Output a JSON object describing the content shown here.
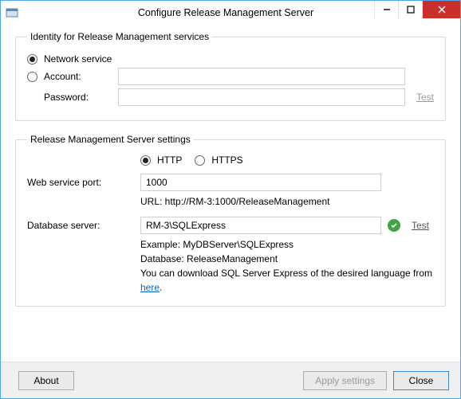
{
  "window": {
    "title": "Configure Release Management Server"
  },
  "identity": {
    "legend": "Identity for Release Management services",
    "network_label": "Network service",
    "account_label": "Account:",
    "password_label": "Password:",
    "account_value": "",
    "password_value": "",
    "test_label": "Test",
    "selected": "network"
  },
  "server": {
    "legend": "Release Management Server settings",
    "http_label": "HTTP",
    "https_label": "HTTPS",
    "protocol": "http",
    "port_label": "Web service port:",
    "port_value": "1000",
    "url_line": "URL: http://RM-3:1000/ReleaseManagement",
    "db_label": "Database server:",
    "db_value": "RM-3\\SQLExpress",
    "db_test_label": "Test",
    "example_line": "Example: MyDBServer\\SQLExpress",
    "database_line": "Database: ReleaseManagement",
    "download_pre": "You can download SQL Server Express of the desired language from ",
    "download_link": "here",
    "download_post": "."
  },
  "footer": {
    "about": "About",
    "apply": "Apply settings",
    "close": "Close"
  }
}
